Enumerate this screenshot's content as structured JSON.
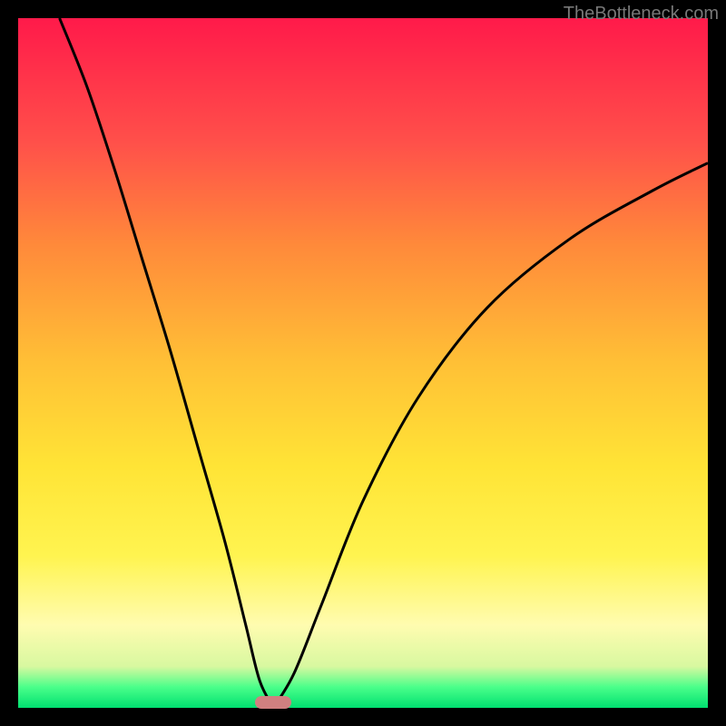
{
  "watermark": "TheBottleneck.com",
  "colors": {
    "frame": "#000000",
    "curve": "#000000",
    "marker": "#d08080",
    "gradient_stops": [
      "#ff1a4a",
      "#ff504a",
      "#ff8a3a",
      "#ffc036",
      "#ffe436",
      "#fff450",
      "#fffcb0",
      "#d8f8a0",
      "#4aff8a",
      "#00e070"
    ]
  },
  "chart_data": {
    "type": "line",
    "title": "",
    "xlabel": "",
    "ylabel": "",
    "x_range": [
      0,
      100
    ],
    "y_range": [
      0,
      100
    ],
    "optimum_x": 37,
    "marker": {
      "x": 37,
      "width": 5
    },
    "curve_left": [
      {
        "x": 6,
        "y": 100
      },
      {
        "x": 10,
        "y": 90
      },
      {
        "x": 14,
        "y": 78
      },
      {
        "x": 18,
        "y": 65
      },
      {
        "x": 22,
        "y": 52
      },
      {
        "x": 26,
        "y": 38
      },
      {
        "x": 30,
        "y": 24
      },
      {
        "x": 33,
        "y": 12
      },
      {
        "x": 35,
        "y": 4
      },
      {
        "x": 37,
        "y": 0
      }
    ],
    "curve_right": [
      {
        "x": 37,
        "y": 0
      },
      {
        "x": 40,
        "y": 5
      },
      {
        "x": 44,
        "y": 15
      },
      {
        "x": 50,
        "y": 30
      },
      {
        "x": 58,
        "y": 45
      },
      {
        "x": 68,
        "y": 58
      },
      {
        "x": 80,
        "y": 68
      },
      {
        "x": 92,
        "y": 75
      },
      {
        "x": 100,
        "y": 79
      }
    ]
  }
}
